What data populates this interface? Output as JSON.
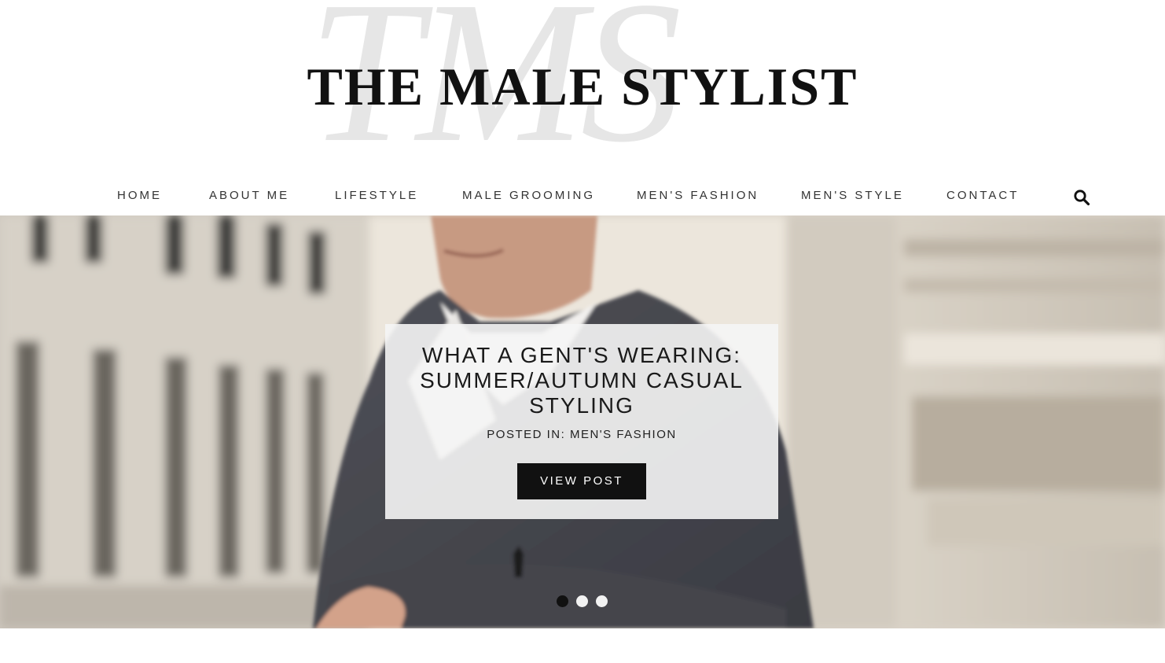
{
  "header": {
    "monogram": "TMS",
    "site_title": "THE MALE STYLIST"
  },
  "nav": {
    "items": [
      {
        "label": "HOME"
      },
      {
        "label": "ABOUT ME"
      },
      {
        "label": "LIFESTYLE"
      },
      {
        "label": "MALE GROOMING"
      },
      {
        "label": "MEN'S FASHION"
      },
      {
        "label": "MEN'S STYLE"
      },
      {
        "label": "CONTACT"
      }
    ],
    "search_icon": "search-icon"
  },
  "hero": {
    "post_title": "WHAT A GENT'S WEARING: SUMMER/AUTUMN CASUAL STYLING",
    "posted_in": "POSTED IN: MEN'S FASHION",
    "button_label": "VIEW POST",
    "slides_total": 3,
    "active_slide": 1
  },
  "colors": {
    "text": "#111111",
    "button_bg": "#111111",
    "button_text": "#ffffff",
    "card_bg": "#f5f5f5",
    "monogram": "#e6e6e6"
  }
}
